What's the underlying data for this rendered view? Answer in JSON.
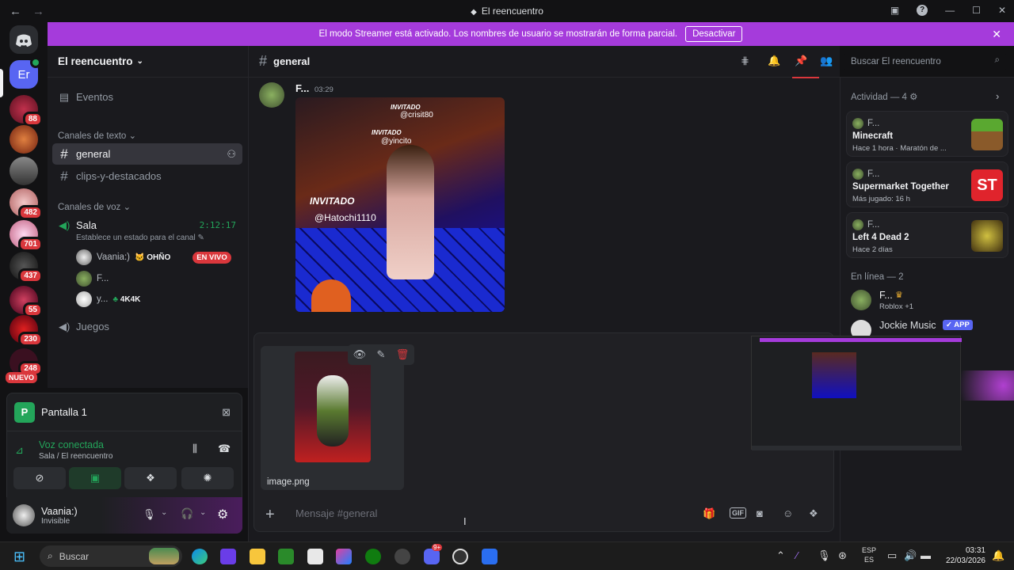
{
  "window": {
    "title": "El reencuentro"
  },
  "banner": {
    "text": "El modo Streamer está activado. Los nombres de usuario se mostrarán de forma parcial.",
    "button": "Desactivar"
  },
  "rail": {
    "dm_label": "Er",
    "badges": [
      "88",
      "482",
      "701",
      "437",
      "55",
      "230",
      "248"
    ],
    "new_label": "NUEVO"
  },
  "server": {
    "name": "El reencuentro"
  },
  "sidebar": {
    "events": "Eventos",
    "text_category": "Canales de texto",
    "text_channels": [
      "general",
      "clips-y-destacados"
    ],
    "voice_category": "Canales de voz",
    "voice_channel": {
      "name": "Sala",
      "timer": "2:12:17",
      "status": "Establece un estado para el canal"
    },
    "voice_users": [
      {
        "name": "Vaania:)",
        "tag": "OHÑO",
        "live": "EN VIVO"
      },
      {
        "name": "F...",
        "tag": "",
        "live": ""
      },
      {
        "name": "y...",
        "tag": "4K4K",
        "live": ""
      }
    ],
    "voice_channel_2": "Juegos"
  },
  "voice_panel": {
    "screen_label": "Pantalla 1",
    "connected": "Voz conectada",
    "location": "Sala / El reencuentro"
  },
  "user": {
    "name": "Vaania:)",
    "status": "Invisible"
  },
  "chat": {
    "channel": "general",
    "message": {
      "author": "F...",
      "time": "03:29"
    },
    "image_labels": {
      "tag1": "INVITADO",
      "user1": "@crisit80",
      "tag2": "INVITADO",
      "user2": "@yincito",
      "tag3": "INVITADO",
      "user3": "@Hatochi1110"
    },
    "attachment": {
      "filename": "image.png"
    },
    "composer_placeholder": "Mensaje #general"
  },
  "search": {
    "placeholder": "Buscar El reencuentro"
  },
  "members": {
    "activity_header": "Actividad — 4",
    "activities": [
      {
        "user": "F...",
        "game": "Minecraft",
        "meta": "Hace 1 hora  ·  Maratón de ..."
      },
      {
        "user": "F...",
        "game": "Supermarket Together",
        "meta": "Más jugado: 16 h"
      },
      {
        "user": "F...",
        "game": "Left 4 Dead 2",
        "meta": "Hace 2 días"
      }
    ],
    "online_header": "En línea — 2",
    "online": [
      {
        "name": "F...",
        "sub": "Roblox +1"
      },
      {
        "name": "Jockie Music",
        "badge": "APP"
      }
    ]
  },
  "taskbar": {
    "search": "Buscar",
    "lang1": "ESP",
    "lang2": "ES",
    "time": "03:31",
    "date": "22/03/2026",
    "discord_badge": "9+"
  },
  "colors": {
    "accent": "#a53bdb",
    "danger": "#da373c",
    "online": "#23a55a",
    "brand": "#5865f2"
  }
}
